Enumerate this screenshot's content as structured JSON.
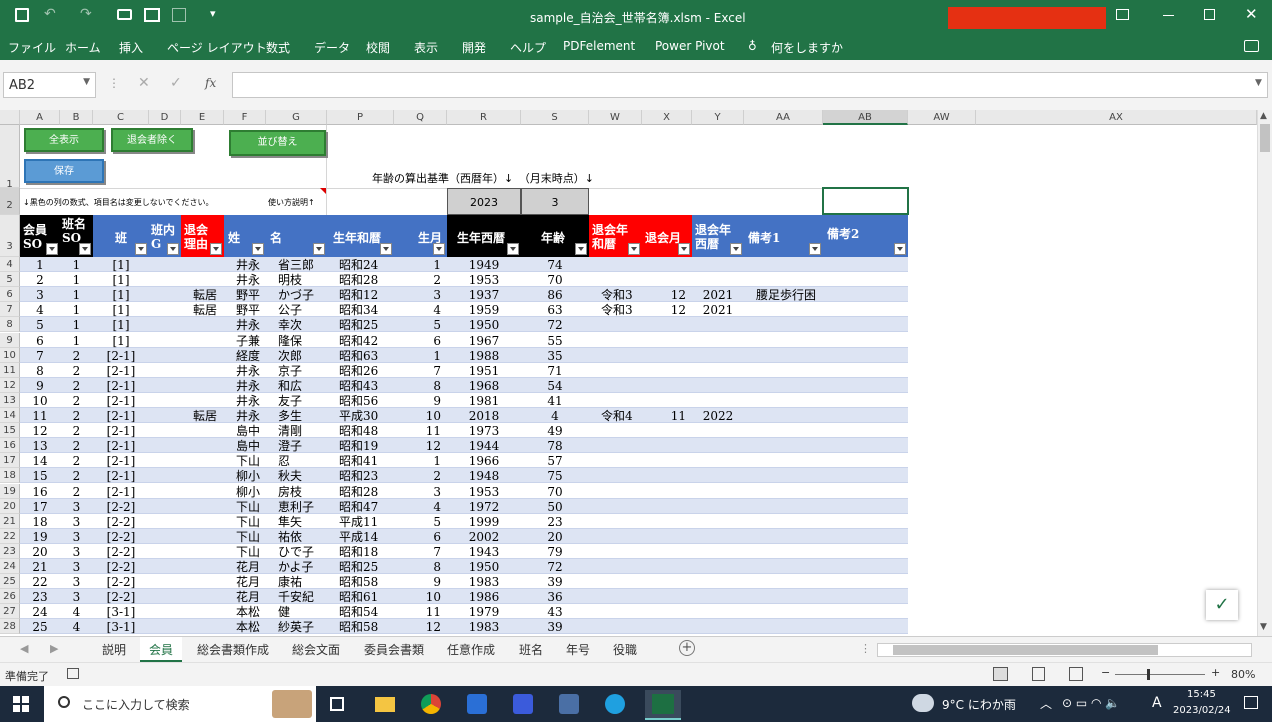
{
  "window": {
    "title": "sample_自治会_世帯名簿.xlsm  -  Excel"
  },
  "ribbon_tabs": [
    "ファイル",
    "ホーム",
    "挿入",
    "ページ レイアウト",
    "数式",
    "データ",
    "校閲",
    "表示",
    "開発",
    "ヘルプ",
    "PDFelement",
    "Power Pivot",
    "何をしますか"
  ],
  "namebox": "AB2",
  "fx_label": "fx",
  "columns": [
    "A",
    "B",
    "C",
    "D",
    "E",
    "F",
    "G",
    "P",
    "Q",
    "R",
    "S",
    "W",
    "X",
    "Y",
    "AA",
    "AB",
    "AW",
    "AX"
  ],
  "buttons": {
    "show_all": "全表示",
    "exclude": "退会者除く",
    "sort": "並び替え",
    "save": "保存"
  },
  "basis_label": "年齢の算出基準（西暦年）↓　（月末時点）↓",
  "basis_year": "2023",
  "basis_month": "3",
  "note": "↓黒色の列の数式、項目名は変更しないでください。",
  "usage_note": "使い方説明↑",
  "headers": {
    "sort_no": "会員SO",
    "house_sort": "班名SO",
    "han": "班",
    "han_g": "班内G",
    "quit_reason": "退会理由",
    "sei": "姓",
    "mei": "名",
    "birth_wareki": "生年和暦",
    "birth_month": "生月",
    "birth_seireki": "生年西暦",
    "age": "年齢",
    "quit_wareki": "退会年和暦",
    "quit_month": "退会月",
    "quit_seireki": "退会年西暦",
    "memo1": "備考1",
    "memo2": "備考2"
  },
  "row_numbers": [
    "1",
    "2",
    "3",
    "4",
    "5",
    "6",
    "7",
    "8",
    "9",
    "10",
    "11",
    "12",
    "13",
    "14",
    "15",
    "16",
    "17",
    "18",
    "19",
    "20",
    "21",
    "22",
    "23",
    "24",
    "25",
    "26",
    "27",
    "28"
  ],
  "rows": [
    [
      "1",
      "1",
      "[1]",
      "",
      "",
      "井永",
      "省三郎",
      "昭和24",
      "1",
      "1949",
      "74",
      "",
      "",
      "",
      ""
    ],
    [
      "2",
      "1",
      "[1]",
      "",
      "",
      "井永",
      "明枝",
      "昭和28",
      "2",
      "1953",
      "70",
      "",
      "",
      "",
      ""
    ],
    [
      "3",
      "1",
      "[1]",
      "",
      "転居",
      "野平",
      "かづ子",
      "昭和12",
      "3",
      "1937",
      "86",
      "令和3",
      "12",
      "2021",
      "腰足歩行困"
    ],
    [
      "4",
      "1",
      "[1]",
      "",
      "転居",
      "野平",
      "公子",
      "昭和34",
      "4",
      "1959",
      "63",
      "令和3",
      "12",
      "2021",
      ""
    ],
    [
      "5",
      "1",
      "[1]",
      "",
      "",
      "井永",
      "幸次",
      "昭和25",
      "5",
      "1950",
      "72",
      "",
      "",
      "",
      ""
    ],
    [
      "6",
      "1",
      "[1]",
      "",
      "",
      "子兼",
      "隆保",
      "昭和42",
      "6",
      "1967",
      "55",
      "",
      "",
      "",
      ""
    ],
    [
      "7",
      "2",
      "[2-1]",
      "",
      "",
      "経度",
      "次郎",
      "昭和63",
      "1",
      "1988",
      "35",
      "",
      "",
      "",
      ""
    ],
    [
      "8",
      "2",
      "[2-1]",
      "",
      "",
      "井永",
      "京子",
      "昭和26",
      "7",
      "1951",
      "71",
      "",
      "",
      "",
      ""
    ],
    [
      "9",
      "2",
      "[2-1]",
      "",
      "",
      "井永",
      "和広",
      "昭和43",
      "8",
      "1968",
      "54",
      "",
      "",
      "",
      ""
    ],
    [
      "10",
      "2",
      "[2-1]",
      "",
      "",
      "井永",
      "友子",
      "昭和56",
      "9",
      "1981",
      "41",
      "",
      "",
      "",
      ""
    ],
    [
      "11",
      "2",
      "[2-1]",
      "",
      "転居",
      "井永",
      "多生",
      "平成30",
      "10",
      "2018",
      "4",
      "令和4",
      "11",
      "2022",
      ""
    ],
    [
      "12",
      "2",
      "[2-1]",
      "",
      "",
      "島中",
      "清剛",
      "昭和48",
      "11",
      "1973",
      "49",
      "",
      "",
      "",
      ""
    ],
    [
      "13",
      "2",
      "[2-1]",
      "",
      "",
      "島中",
      "澄子",
      "昭和19",
      "12",
      "1944",
      "78",
      "",
      "",
      "",
      ""
    ],
    [
      "14",
      "2",
      "[2-1]",
      "",
      "",
      "下山",
      "忍",
      "昭和41",
      "1",
      "1966",
      "57",
      "",
      "",
      "",
      ""
    ],
    [
      "15",
      "2",
      "[2-1]",
      "",
      "",
      "柳小",
      "秋夫",
      "昭和23",
      "2",
      "1948",
      "75",
      "",
      "",
      "",
      ""
    ],
    [
      "16",
      "2",
      "[2-1]",
      "",
      "",
      "柳小",
      "房枝",
      "昭和28",
      "3",
      "1953",
      "70",
      "",
      "",
      "",
      ""
    ],
    [
      "17",
      "3",
      "[2-2]",
      "",
      "",
      "下山",
      "恵利子",
      "昭和47",
      "4",
      "1972",
      "50",
      "",
      "",
      "",
      ""
    ],
    [
      "18",
      "3",
      "[2-2]",
      "",
      "",
      "下山",
      "隼矢",
      "平成11",
      "5",
      "1999",
      "23",
      "",
      "",
      "",
      ""
    ],
    [
      "19",
      "3",
      "[2-2]",
      "",
      "",
      "下山",
      "祐依",
      "平成14",
      "6",
      "2002",
      "20",
      "",
      "",
      "",
      ""
    ],
    [
      "20",
      "3",
      "[2-2]",
      "",
      "",
      "下山",
      "ひで子",
      "昭和18",
      "7",
      "1943",
      "79",
      "",
      "",
      "",
      ""
    ],
    [
      "21",
      "3",
      "[2-2]",
      "",
      "",
      "花月",
      "かよ子",
      "昭和25",
      "8",
      "1950",
      "72",
      "",
      "",
      "",
      ""
    ],
    [
      "22",
      "3",
      "[2-2]",
      "",
      "",
      "花月",
      "康祐",
      "昭和58",
      "9",
      "1983",
      "39",
      "",
      "",
      "",
      ""
    ],
    [
      "23",
      "3",
      "[2-2]",
      "",
      "",
      "花月",
      "千安紀",
      "昭和61",
      "10",
      "1986",
      "36",
      "",
      "",
      "",
      ""
    ],
    [
      "24",
      "4",
      "[3-1]",
      "",
      "",
      "本松",
      "健",
      "昭和54",
      "11",
      "1979",
      "43",
      "",
      "",
      "",
      ""
    ],
    [
      "25",
      "4",
      "[3-1]",
      "",
      "",
      "本松",
      "紗英子",
      "昭和58",
      "12",
      "1983",
      "39",
      "",
      "",
      "",
      ""
    ]
  ],
  "sheet_tabs": [
    "説明",
    "会員",
    "総会書類作成",
    "総会文面",
    "委員会書類",
    "任意作成",
    "班名",
    "年号",
    "役職"
  ],
  "active_tab": "会員",
  "status": {
    "ready": "準備完了",
    "zoom": "80%"
  },
  "taskbar": {
    "search": "ここに入力して検索",
    "weather": "9°C  にわか雨",
    "time": "15:45",
    "date": "2023/02/24",
    "ime": "A"
  },
  "colors": {
    "excel_green": "#217346",
    "header_blue": "#4472c4",
    "header_black": "#000000",
    "header_red": "#ff0000",
    "band": "#dde4f3"
  }
}
